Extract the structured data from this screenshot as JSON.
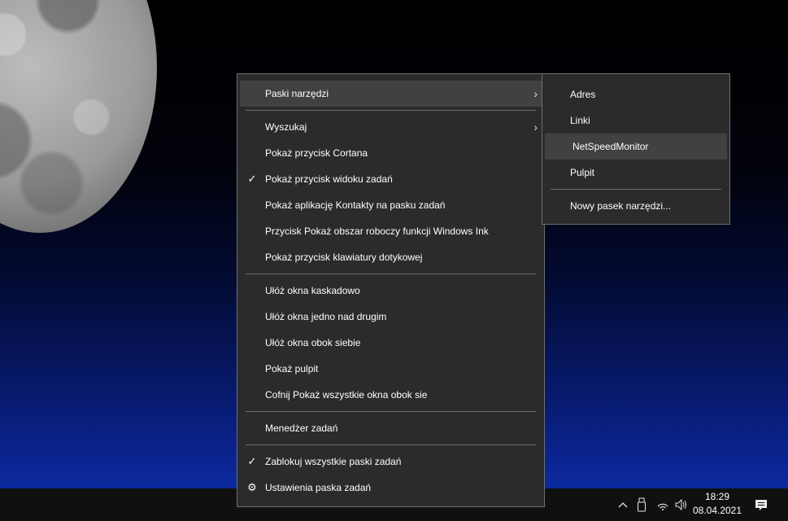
{
  "main_menu": {
    "toolbars": "Paski narzędzi",
    "search": "Wyszukaj",
    "show_cortana": "Pokaż przycisk Cortana",
    "show_task_view": "Pokaż przycisk widoku zadań",
    "show_contacts": "Pokaż aplikację Kontakty na pasku zadań",
    "windows_ink": "Przycisk Pokaż obszar roboczy funkcji Windows Ink",
    "touch_keyboard": "Pokaż przycisk klawiatury dotykowej",
    "cascade": "Ułóż okna kaskadowo",
    "stacked": "Ułóż okna jedno nad drugim",
    "side_by_side": "Ułóż okna obok siebie",
    "show_desktop": "Pokaż pulpit",
    "undo_side_by_side": "Cofnij Pokaż wszystkie okna obok sie",
    "task_manager": "Menedżer zadań",
    "lock_taskbars": "Zablokuj wszystkie paski zadań",
    "taskbar_settings": "Ustawienia paska zadań"
  },
  "sub_menu": {
    "address": "Adres",
    "links": "Linki",
    "netspeed": "NetSpeedMonitor",
    "desktop": "Pulpit",
    "new_toolbar": "Nowy pasek narzędzi..."
  },
  "icons": {
    "check": "✓",
    "arrow": "›",
    "gear": "⚙",
    "chevron_up": "⌃",
    "usb": "🖫",
    "wifi": "wifi",
    "speaker": "speaker",
    "notification": "notification"
  },
  "taskbar": {
    "time": "18:29",
    "date": "08.04.2021"
  },
  "colors": {
    "menu_bg": "#2b2b2b",
    "highlight": "#414141",
    "taskbar_bg": "#101010"
  }
}
